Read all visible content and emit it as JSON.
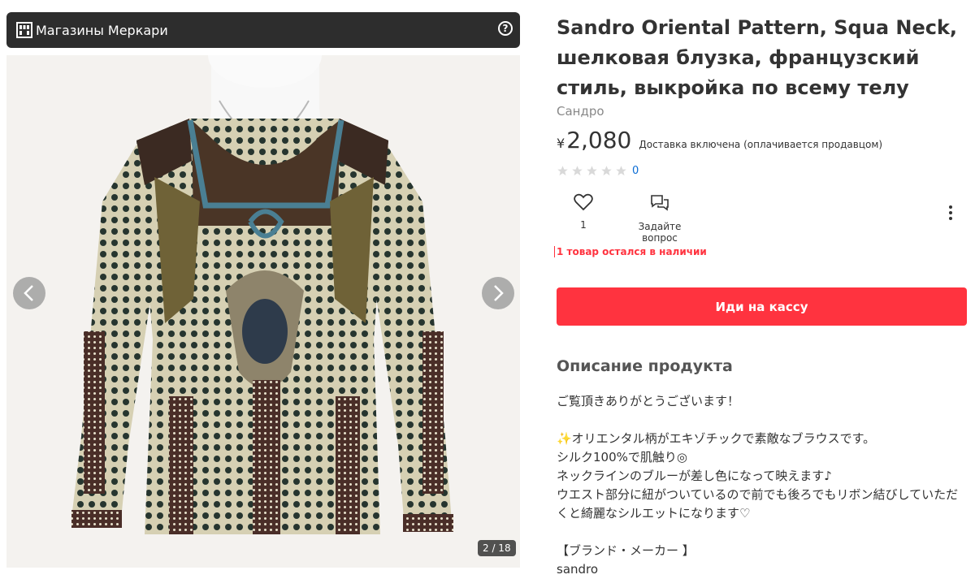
{
  "shop": {
    "name": "Магазины Меркари",
    "help_symbol": "?"
  },
  "gallery": {
    "counter": "2 / 18"
  },
  "item": {
    "title": "Sandro Oriental Pattern, Squa Neck, шелковая блузка, французский стиль, выкройка по всему телу",
    "brand": "Сандро",
    "currency": "¥",
    "price": "2,080",
    "shipping": "Доставка включена (оплачивается продавцом)",
    "rating_count": "0",
    "stars_filled": 0,
    "like_count": "1",
    "ask_label": "Задайте вопрос",
    "stock_notice": "1 товар остался в наличии",
    "buy_label": "Иди на кассу"
  },
  "description": {
    "heading": "Описание продукта",
    "lines": [
      "ご覧頂きありがとうございます！",
      "",
      "✨オリエンタル柄がエキゾチックで素敵なブラウスです。",
      "シルク100%で肌触り◎",
      "ネックラインのブルーが差し色になって映えます♪",
      "ウエスト部分に紐がついているので前でも後ろでもリボン結びしていただくと綺麗なシルエットになります♡",
      "",
      "【ブランド・メーカー 】",
      "sandro"
    ]
  },
  "icons": {
    "shop": "shop-grid-icon",
    "help": "help-circle-icon",
    "prev": "chevron-left-icon",
    "next": "chevron-right-icon",
    "star": "star-icon",
    "like": "heart-icon",
    "ask": "chat-bubbles-icon",
    "more": "more-vertical-icon"
  },
  "colors": {
    "accent": "#ff333f",
    "link": "#0b6cd5",
    "header_bg": "#2d2d2d",
    "star_empty": "#d9d9d9"
  }
}
